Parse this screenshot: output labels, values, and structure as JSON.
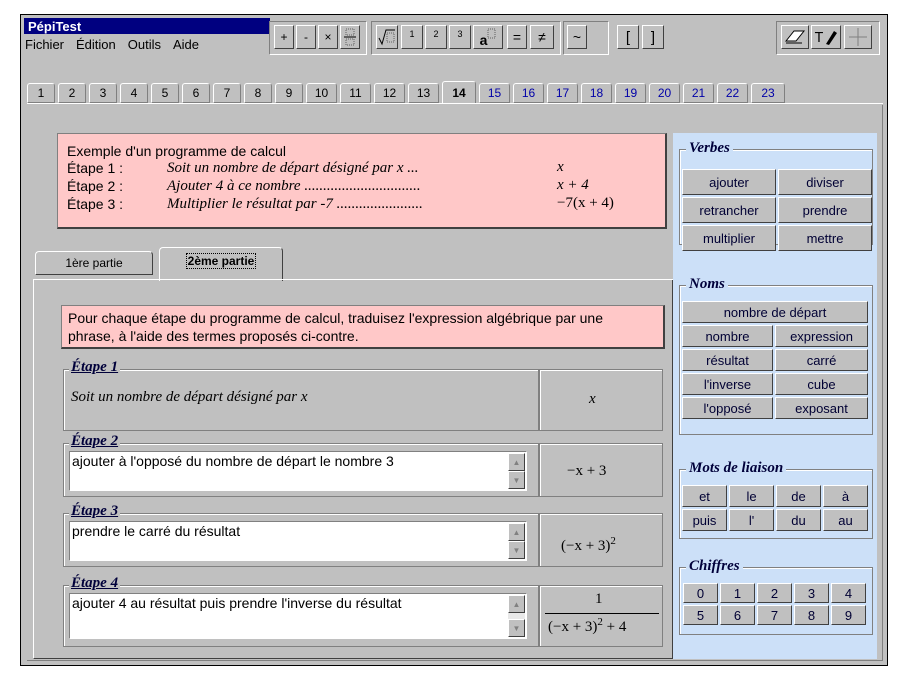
{
  "window": {
    "title": "PépiTest"
  },
  "menu": [
    "Fichier",
    "Édition",
    "Outils",
    "Aide"
  ],
  "toolbar": {
    "plus": "+",
    "minus": "-",
    "times": "×",
    "sup1": "1",
    "sup2": "2",
    "sup3": "3",
    "power_a": "a",
    "equals": "=",
    "not_equal": "≠",
    "approx": "~",
    "lbracket": "[",
    "rbracket": "]"
  },
  "tabs": [
    "1",
    "2",
    "3",
    "4",
    "5",
    "6",
    "7",
    "8",
    "9",
    "10",
    "11",
    "12",
    "13",
    "14",
    "15",
    "16",
    "17",
    "18",
    "19",
    "20",
    "21",
    "22",
    "23"
  ],
  "active_tab": "14",
  "example": {
    "title": "Exemple d'un programme de calcul",
    "steps": [
      {
        "label": "Étape 1 :",
        "text": "Soit un nombre de départ désigné par x ...",
        "expr": "x"
      },
      {
        "label": "Étape 2 :",
        "text": "Ajouter 4 à ce nombre ...............................",
        "expr": "x + 4"
      },
      {
        "label": "Étape 3 :",
        "text": "Multiplier le résultat par -7 .......................",
        "expr": "−7(x + 4)"
      }
    ]
  },
  "subtabs": [
    "1ère partie",
    "2ème partie"
  ],
  "instructions": "Pour chaque étape du programme de calcul, traduisez l'expression algébrique par une phrase, à l'aide des termes proposés ci-contre.",
  "steps": [
    {
      "title": "Étape 1",
      "text": "Soit un nombre de départ désigné par x",
      "expr": "x"
    },
    {
      "title": "Étape 2",
      "text": "ajouter à l'opposé du nombre de départ le nombre 3",
      "expr": "−x + 3"
    },
    {
      "title": "Étape 3",
      "text": "prendre le carré du résultat",
      "expr": "(−x + 3)",
      "expr_sup": "2"
    },
    {
      "title": "Étape 4",
      "text": "ajouter 4 au résultat puis prendre l'inverse du résultat",
      "numerator": "1",
      "denominator": "(−x + 3)",
      "denominator_sup": "2",
      "denominator_tail": " + 4"
    }
  ],
  "panels": {
    "verbes": {
      "title": "Verbes",
      "items": [
        "ajouter",
        "diviser",
        "retrancher",
        "prendre",
        "multiplier",
        "mettre"
      ]
    },
    "noms": {
      "title": "Noms",
      "wide": "nombre de départ",
      "items": [
        "nombre",
        "expression",
        "résultat",
        "carré",
        "l'inverse",
        "cube",
        "l'opposé",
        "exposant"
      ]
    },
    "liaison": {
      "title": "Mots de liaison",
      "items": [
        "et",
        "le",
        "de",
        "à",
        "puis",
        "l'",
        "du",
        "au"
      ]
    },
    "chiffres": {
      "title": "Chiffres",
      "items": [
        "0",
        "1",
        "2",
        "3",
        "4",
        "5",
        "6",
        "7",
        "8",
        "9"
      ]
    }
  },
  "colors": {
    "pink": "#ffc8c8",
    "side_panel": "#cce0f8",
    "title_bg": "#000080"
  }
}
